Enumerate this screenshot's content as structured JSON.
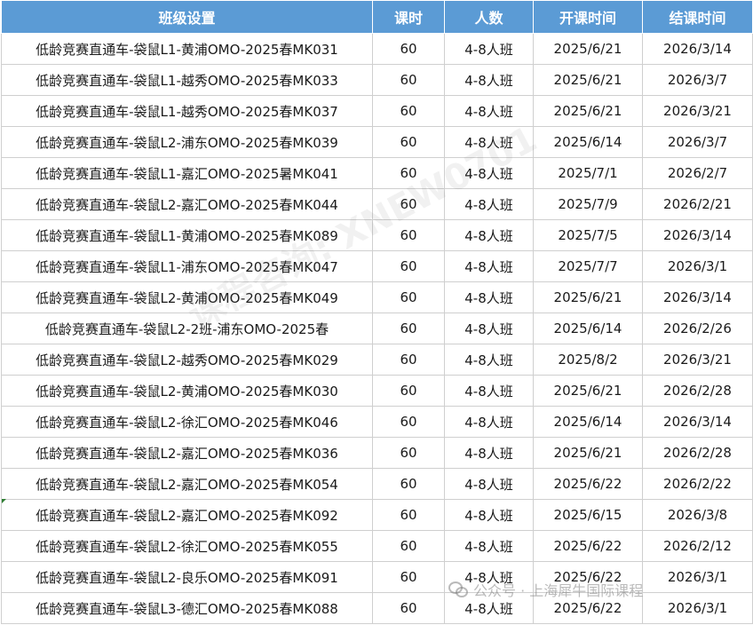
{
  "headers": [
    "班级设置",
    "课时",
    "人数",
    "开课时间",
    "结课时间"
  ],
  "rows": [
    [
      "低龄竞赛直通车-袋鼠L1-黄浦OMO-2025春MK031",
      "60",
      "4-8人班",
      "2025/6/21",
      "2026/3/14"
    ],
    [
      "低龄竞赛直通车-袋鼠L1-越秀OMO-2025春MK033",
      "60",
      "4-8人班",
      "2025/6/21",
      "2026/3/7"
    ],
    [
      "低龄竞赛直通车-袋鼠L1-越秀OMO-2025春MK037",
      "60",
      "4-8人班",
      "2025/6/21",
      "2026/3/21"
    ],
    [
      "低龄竞赛直通车-袋鼠L2-浦东OMO-2025春MK039",
      "60",
      "4-8人班",
      "2025/6/14",
      "2026/3/7"
    ],
    [
      "低龄竞赛直通车-袋鼠L1-嘉汇OMO-2025暑MK041",
      "60",
      "4-8人班",
      "2025/7/1",
      "2026/2/7"
    ],
    [
      "低龄竞赛直通车-袋鼠L2-嘉汇OMO-2025春MK044",
      "60",
      "4-8人班",
      "2025/7/9",
      "2026/2/21"
    ],
    [
      "低龄竞赛直通车-袋鼠L1-黄浦OMO-2025春MK089",
      "60",
      "4-8人班",
      "2025/7/5",
      "2026/3/14"
    ],
    [
      "低龄竞赛直通车-袋鼠L1-浦东OMO-2025春MK047",
      "60",
      "4-8人班",
      "2025/7/7",
      "2026/3/1"
    ],
    [
      "低龄竞赛直通车-袋鼠L2-黄浦OMO-2025春MK049",
      "60",
      "4-8人班",
      "2025/6/21",
      "2026/3/14"
    ],
    [
      "低龄竞赛直通车-袋鼠L2-2班-浦东OMO-2025春",
      "60",
      "4-8人班",
      "2025/6/14",
      "2026/2/26"
    ],
    [
      "低龄竞赛直通车-袋鼠L2-越秀OMO-2025春MK029",
      "60",
      "4-8人班",
      "2025/8/2",
      "2026/3/21"
    ],
    [
      "低龄竞赛直通车-袋鼠L2-黄浦OMO-2025春MK030",
      "60",
      "4-8人班",
      "2025/6/21",
      "2026/2/28"
    ],
    [
      "低龄竞赛直通车-袋鼠L2-徐汇OMO-2025春MK046",
      "60",
      "4-8人班",
      "2025/6/14",
      "2026/3/14"
    ],
    [
      "低龄竞赛直通车-袋鼠L2-嘉汇OMO-2025春MK036",
      "60",
      "4-8人班",
      "2025/6/21",
      "2026/2/28"
    ],
    [
      "低龄竞赛直通车-袋鼠L2-嘉汇OMO-2025春MK054",
      "60",
      "4-8人班",
      "2025/6/22",
      "2026/2/22"
    ],
    [
      "低龄竞赛直通车-袋鼠L2-嘉汇OMO-2025春MK092",
      "60",
      "4-8人班",
      "2025/6/15",
      "2026/3/8"
    ],
    [
      "低龄竞赛直通车-袋鼠L2-徐汇OMO-2025春MK055",
      "60",
      "4-8人班",
      "2025/6/22",
      "2026/2/12"
    ],
    [
      "低龄竞赛直通车-袋鼠L2-良乐OMO-2025春MK091",
      "60",
      "4-8人班",
      "2025/6/22",
      "2026/3/1"
    ],
    [
      "低龄竞赛直通车-袋鼠L3-德汇OMO-2025春MK088",
      "60",
      "4-8人班",
      "2025/6/22",
      "2026/3/1"
    ]
  ],
  "watermark": "课程咨询: XNEW0701",
  "footer_mark": "公众号 · 上海犀牛国际课程",
  "footer_icon": "wechat-icon",
  "colors": {
    "header_bg": "#5b9bd5",
    "header_text": "#ffffff",
    "grid": "#cfcfcf"
  }
}
